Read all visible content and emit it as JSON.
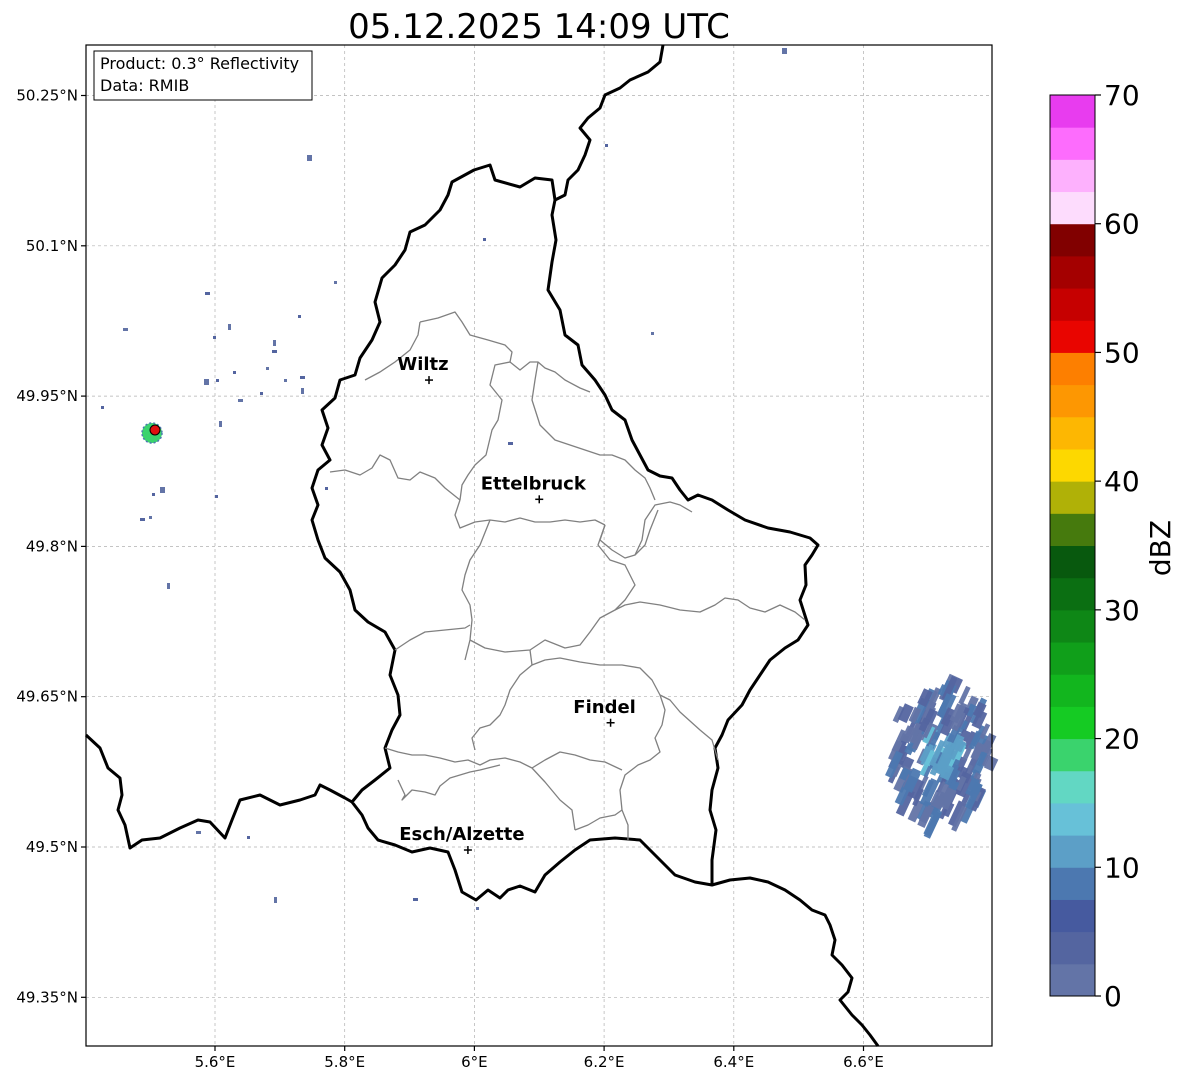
{
  "title": "05.12.2025 14:09 UTC",
  "info_box": {
    "product": "Product: 0.3° Reflectivity",
    "data": "Data: RMIB"
  },
  "axes": {
    "lat_ticks": [
      {
        "value": 50.25,
        "label": "50.25°N"
      },
      {
        "value": 50.1,
        "label": "50.1°N"
      },
      {
        "value": 49.95,
        "label": "49.95°N"
      },
      {
        "value": 49.8,
        "label": "49.8°N"
      },
      {
        "value": 49.65,
        "label": "49.65°N"
      },
      {
        "value": 49.5,
        "label": "49.5°N"
      },
      {
        "value": 49.35,
        "label": "49.35°N"
      }
    ],
    "lon_ticks": [
      {
        "value": 5.6,
        "label": "5.6°E"
      },
      {
        "value": 5.8,
        "label": "5.8°E"
      },
      {
        "value": 6.0,
        "label": "6°E"
      },
      {
        "value": 6.2,
        "label": "6.2°E"
      },
      {
        "value": 6.4,
        "label": "6.4°E"
      },
      {
        "value": 6.6,
        "label": "6.6°E"
      }
    ],
    "lon_range": [
      5.4,
      6.8
    ],
    "lat_range": [
      49.3,
      50.3
    ],
    "grid": true
  },
  "cities": [
    {
      "name": "Wiltz",
      "lon": 5.93,
      "lat": 49.966
    },
    {
      "name": "Ettelbruck",
      "lon": 6.1,
      "lat": 49.847
    },
    {
      "name": "Findel",
      "lon": 6.21,
      "lat": 49.624
    },
    {
      "name": "Esch/Alzette",
      "lon": 5.99,
      "lat": 49.497
    }
  ],
  "radar_site": {
    "lon": 5.505,
    "lat": 49.914,
    "color": "#e01010"
  },
  "colorbar": {
    "label": "dBZ",
    "min": 0,
    "max": 70,
    "step": 2.5,
    "ticks": [
      {
        "value": 0,
        "label": "0"
      },
      {
        "value": 10,
        "label": "10"
      },
      {
        "value": 20,
        "label": "20"
      },
      {
        "value": 30,
        "label": "30"
      },
      {
        "value": 40,
        "label": "40"
      },
      {
        "value": 50,
        "label": "50"
      },
      {
        "value": 60,
        "label": "60"
      },
      {
        "value": 70,
        "label": "70"
      }
    ],
    "colors": [
      "#6374a7",
      "#5465a0",
      "#465a9f",
      "#4c78b0",
      "#5c9fc7",
      "#67c1d8",
      "#62d7c3",
      "#3ad36d",
      "#15cb23",
      "#12b61e",
      "#109f1a",
      "#0e8716",
      "#0b6f12",
      "#08590e",
      "#467a0d",
      "#b0b107",
      "#fdd800",
      "#fdb702",
      "#fd9702",
      "#fd7f00",
      "#e90500",
      "#c60000",
      "#a40000",
      "#810000",
      "#fddcfd",
      "#fdb1fd",
      "#fd6cfd",
      "#e83cef"
    ]
  }
}
